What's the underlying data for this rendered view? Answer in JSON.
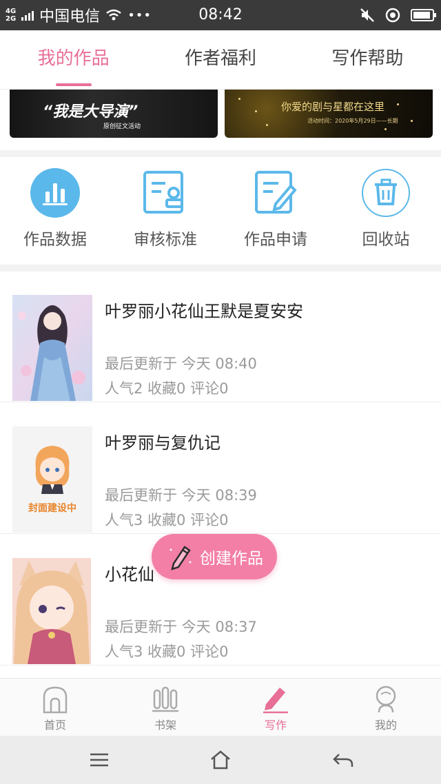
{
  "status_bar": {
    "network_type": "4G 2G",
    "carrier": "中国电信",
    "time": "08:42"
  },
  "tabs": [
    {
      "label": "我的作品",
      "active": true
    },
    {
      "label": "作者福利",
      "active": false
    },
    {
      "label": "写作帮助",
      "active": false
    }
  ],
  "banners": [
    {
      "headline": "“我是大导演”",
      "subtitle": "原创征文活动"
    },
    {
      "headline": "你爱的剧与星都在这里",
      "subtitle": "活动时间：2020年5月29日——长期"
    }
  ],
  "quick_actions": [
    {
      "label": "作品数据",
      "icon": "bar-chart-icon"
    },
    {
      "label": "审核标准",
      "icon": "review-standard-icon"
    },
    {
      "label": "作品申请",
      "icon": "edit-document-icon"
    },
    {
      "label": "回收站",
      "icon": "trash-icon"
    }
  ],
  "works": [
    {
      "title": "叶罗丽小花仙王默是夏安安",
      "updated": "最后更新于 今天 08:40",
      "stats": "人气2 收藏0 评论0",
      "cover": "anime-girl-cover"
    },
    {
      "title": "叶罗丽与复仇记",
      "updated": "最后更新于 今天 08:39",
      "stats": "人气3 收藏0 评论0",
      "cover": "placeholder-cover",
      "cover_label": "封面建设中"
    },
    {
      "title": "小花仙",
      "updated": "最后更新于 今天 08:37",
      "stats": "人气3 收藏0 评论0",
      "cover": "catgirl-cover"
    }
  ],
  "create_button": {
    "label": "创建作品",
    "icon": "pencil-icon"
  },
  "bottom_nav": [
    {
      "label": "首页",
      "icon": "home-icon",
      "active": false
    },
    {
      "label": "书架",
      "icon": "bookshelf-icon",
      "active": false
    },
    {
      "label": "写作",
      "icon": "write-icon",
      "active": true
    },
    {
      "label": "我的",
      "icon": "profile-icon",
      "active": false
    }
  ],
  "colors": {
    "accent": "#e86f96",
    "icon_blue": "#5bb8ea",
    "create_button": "#f37fa7",
    "status_bar": "#3a3a3a"
  }
}
